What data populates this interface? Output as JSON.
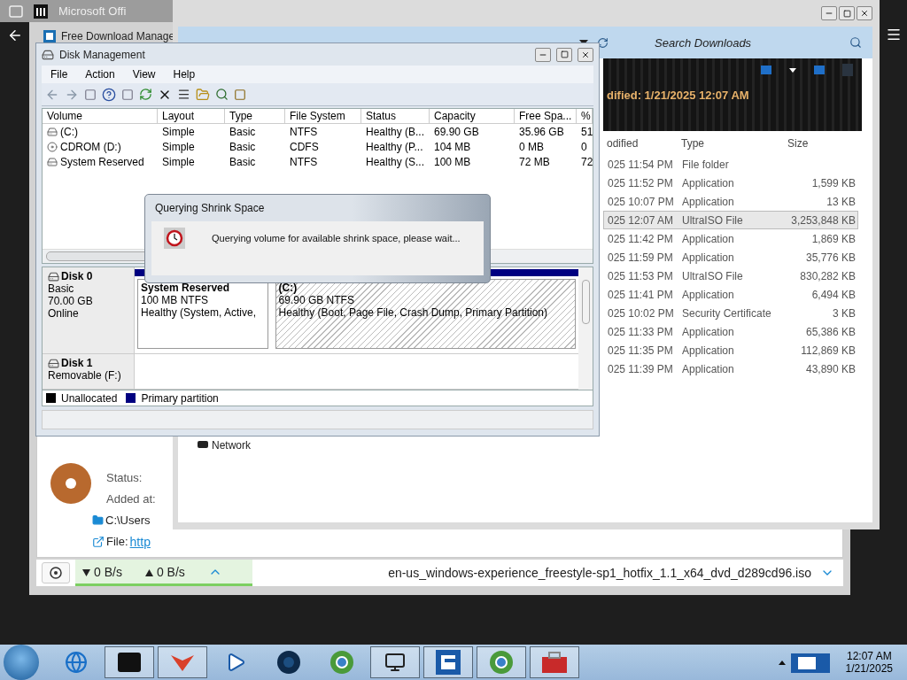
{
  "top_strip": {
    "tab": "Microsoft Offi"
  },
  "download_manager": {
    "title": "Free Download Manage",
    "details": {
      "status_label": "Status:",
      "added_label": "Added at:",
      "folder": "C:\\Users",
      "file_label": "File:",
      "file_link": "http"
    },
    "status_bar": {
      "download_speed": "0 B/s",
      "upload_speed": "0 B/s",
      "file_name": "en-us_windows-experience_freestyle-sp1_hotfix_1.1_x64_dvd_d289cd96.iso"
    }
  },
  "explorer": {
    "search": {
      "placeholder": "Search Downloads"
    },
    "header_info": "dified: 1/21/2025 12:07 AM",
    "nav": [
      {
        "label": "Network"
      }
    ],
    "columns": [
      "odified",
      "Type",
      "Size"
    ],
    "rows": [
      {
        "modified": "025 11:54 PM",
        "type": "File folder",
        "selected": false
      },
      {
        "modified": "025 11:52 PM",
        "type": "Application",
        "size": "1,599 KB",
        "selected": false
      },
      {
        "modified": "025 10:07 PM",
        "type": "Application",
        "size": "13 KB",
        "selected": false
      },
      {
        "modified": "025 12:07 AM",
        "type": "UltraISO File",
        "size": "3,253,848 KB",
        "selected": true
      },
      {
        "modified": "025 11:42 PM",
        "type": "Application",
        "size": "1,869 KB",
        "selected": false
      },
      {
        "modified": "025 11:59 PM",
        "type": "Application",
        "size": "35,776 KB",
        "selected": false
      },
      {
        "modified": "025 11:53 PM",
        "type": "UltraISO File",
        "size": "830,282 KB",
        "selected": false
      },
      {
        "modified": "025 11:41 PM",
        "type": "Application",
        "size": "6,494 KB",
        "selected": false
      },
      {
        "modified": "025 10:02 PM",
        "type": "Security Certificate",
        "size": "3 KB",
        "selected": false
      },
      {
        "modified": "025 11:33 PM",
        "type": "Application",
        "size": "65,386 KB",
        "selected": false
      },
      {
        "modified": "025 11:35 PM",
        "type": "Application",
        "size": "112,869 KB",
        "selected": false
      },
      {
        "modified": "025 11:39 PM",
        "type": "Application",
        "size": "43,890 KB",
        "selected": false
      }
    ]
  },
  "disk_management": {
    "title": "Disk Management",
    "menu": [
      "File",
      "Action",
      "View",
      "Help"
    ],
    "columns": [
      "Volume",
      "Layout",
      "Type",
      "File System",
      "Status",
      "Capacity",
      "Free Spa...",
      "%"
    ],
    "volumes": [
      {
        "kind": "disk",
        "cells": [
          "(C:)",
          "Simple",
          "Basic",
          "NTFS",
          "Healthy (B...",
          "69.90 GB",
          "35.96 GB",
          "51"
        ]
      },
      {
        "kind": "cdrom",
        "cells": [
          "CDROM (D:)",
          "Simple",
          "Basic",
          "CDFS",
          "Healthy (P...",
          "104 MB",
          "0 MB",
          "0"
        ]
      },
      {
        "kind": "disk",
        "cells": [
          "System Reserved",
          "Simple",
          "Basic",
          "NTFS",
          "Healthy (S...",
          "100 MB",
          "72 MB",
          "72"
        ]
      }
    ],
    "disks": [
      {
        "name": "Disk 0",
        "lines": [
          "Basic",
          "70.00 GB",
          "Online"
        ],
        "partitions": [
          {
            "name": "System Reserved",
            "size": "100 MB NTFS",
            "status": "Healthy (System, Active,",
            "selected": false
          },
          {
            "name": "(C:)",
            "size": "69.90 GB NTFS",
            "status": "Healthy (Boot, Page File, Crash Dump, Primary Partition)",
            "selected": true
          }
        ]
      },
      {
        "name": "Disk 1",
        "lines": [
          "Removable (F:)"
        ]
      }
    ],
    "legend": [
      {
        "label": "Unallocated",
        "color": "#000000"
      },
      {
        "label": "Primary partition",
        "color": "#000080"
      }
    ]
  },
  "dialog": {
    "title": "Querying Shrink Space",
    "message": "Querying volume for available shrink space, please wait..."
  },
  "taskbar": {
    "time": "12:07 AM",
    "date": "1/21/2025"
  }
}
